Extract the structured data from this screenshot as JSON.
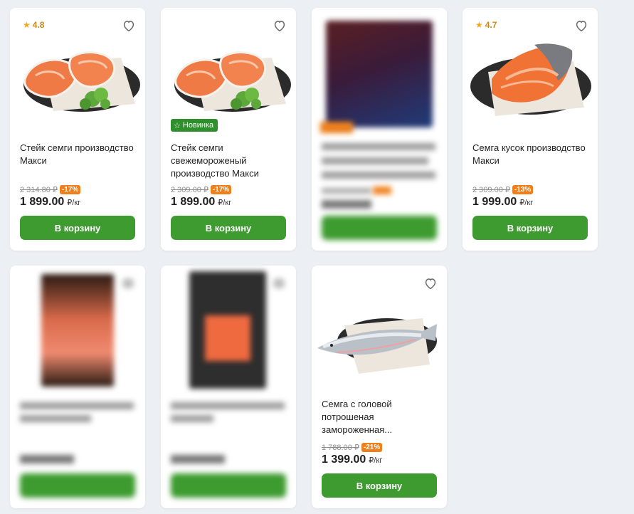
{
  "products": [
    {
      "rating": "4.8",
      "title": "Стейк семги производство Макси",
      "old_price": "2 314.80 ₽",
      "discount": "-17%",
      "price": "1 899.00",
      "unit": "₽/кг",
      "cart_label": "В корзину"
    },
    {
      "badge": "Новинка",
      "title": "Стейк семги свежемороженый производство Макси",
      "old_price": "2 309.00 ₽",
      "discount": "-17%",
      "price": "1 899.00",
      "unit": "₽/кг",
      "cart_label": "В корзину"
    },
    {
      "rating": "4.7",
      "title": "Семга кусок производство Макси",
      "old_price": "2 309.00 ₽",
      "discount": "-13%",
      "price": "1 999.00",
      "unit": "₽/кг",
      "cart_label": "В корзину"
    },
    {
      "title": "Семга с головой потрошеная замороженная...",
      "old_price": "1 788.00 ₽",
      "discount": "-21%",
      "price": "1 399.00",
      "unit": "₽/кг",
      "cart_label": "В корзину"
    }
  ],
  "icons": {
    "favorite": "heart-outline-icon",
    "rating": "star-icon",
    "new": "star-outline-icon"
  },
  "colors": {
    "accent_green": "#3d9b2f",
    "discount_orange": "#ef7f1a",
    "badge_green": "#2f8f2d"
  }
}
